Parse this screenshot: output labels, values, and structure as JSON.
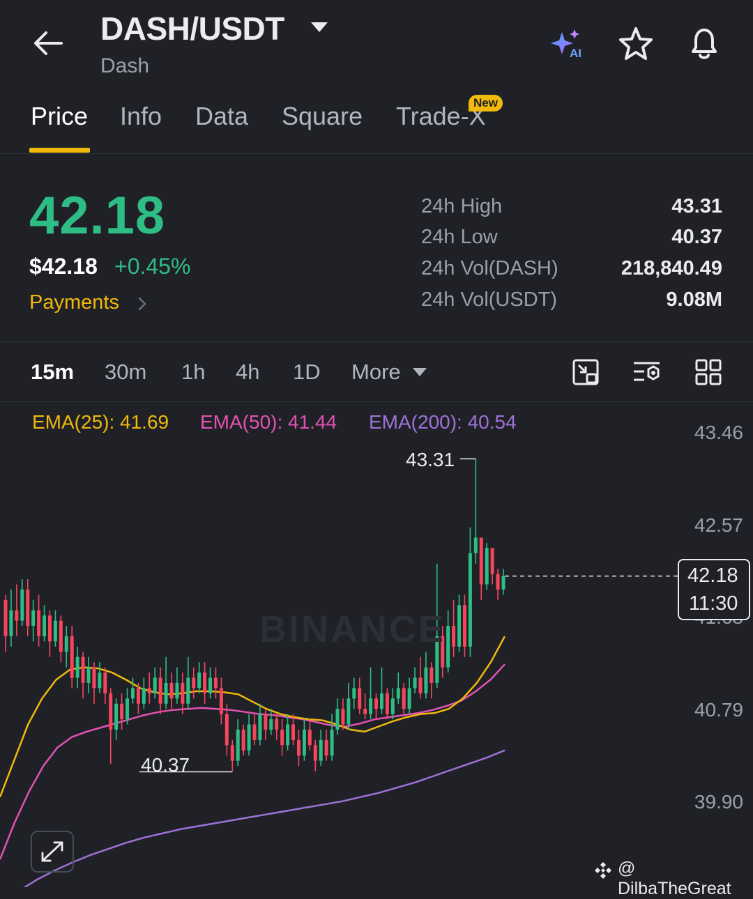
{
  "header": {
    "pair": "DASH/USDT",
    "coin_name": "Dash",
    "icons": [
      "back-arrow-icon",
      "ai-sparkle-icon",
      "star-icon",
      "bell-icon"
    ]
  },
  "tabs": [
    {
      "label": "Price",
      "active": true
    },
    {
      "label": "Info"
    },
    {
      "label": "Data"
    },
    {
      "label": "Square"
    },
    {
      "label": "Trade-X",
      "badge": "New"
    }
  ],
  "price": {
    "last": "42.18",
    "usd": "$42.18",
    "change": "+0.45%",
    "category": "Payments"
  },
  "stats": [
    {
      "label": "24h High",
      "value": "43.31"
    },
    {
      "label": "24h Low",
      "value": "40.37"
    },
    {
      "label": "24h Vol(DASH)",
      "value": "218,840.49"
    },
    {
      "label": "24h Vol(USDT)",
      "value": "9.08M"
    }
  ],
  "intervals": [
    "15m",
    "30m",
    "1h",
    "4h",
    "1D",
    "More"
  ],
  "active_interval": "15m",
  "ema": {
    "ema25": "EMA(25): 41.69",
    "ema50": "EMA(50): 41.44",
    "ema200": "EMA(200): 40.54"
  },
  "colors": {
    "up": "#2ebd85",
    "down": "#f6465d",
    "accent": "#f0b90b",
    "ema25": "#f0b90b",
    "ema50": "#e352b3",
    "ema200": "#9d72d6",
    "background": "#1f2127"
  },
  "chart_data": {
    "type": "candlestick",
    "y_axis_ticks": [
      "43.46",
      "42.57",
      "41.68",
      "40.79",
      "39.90"
    ],
    "ylim": [
      39.6,
      43.7
    ],
    "high_marker": "43.31",
    "low_marker": "40.37",
    "last_price": "42.18",
    "last_time": "11:30",
    "ema25": [
      40.05,
      40.4,
      40.75,
      41.0,
      41.18,
      41.28,
      41.3,
      41.29,
      41.25,
      41.18,
      41.1,
      41.06,
      41.04,
      41.05,
      41.07,
      41.07,
      41.06,
      41.04,
      40.97,
      40.9,
      40.85,
      40.82,
      40.8,
      40.79,
      40.75,
      40.7,
      40.68,
      40.73,
      40.78,
      40.82,
      40.85,
      40.86,
      40.9,
      41.0,
      41.15,
      41.35,
      41.6
    ],
    "ema50": [
      39.45,
      39.8,
      40.1,
      40.35,
      40.53,
      40.63,
      40.68,
      40.72,
      40.76,
      40.8,
      40.84,
      40.87,
      40.89,
      40.9,
      40.91,
      40.9,
      40.89,
      40.87,
      40.85,
      40.84,
      40.82,
      40.8,
      40.77,
      40.74,
      40.73,
      40.76,
      40.8,
      40.82,
      40.84,
      40.86,
      40.89,
      40.93,
      40.98,
      41.07,
      41.18,
      41.33
    ],
    "ema200": [
      39.03,
      39.14,
      39.25,
      39.34,
      39.42,
      39.49,
      39.55,
      39.61,
      39.66,
      39.7,
      39.74,
      39.77,
      39.8,
      39.83,
      39.86,
      39.89,
      39.92,
      39.95,
      39.98,
      40.01,
      40.05,
      40.09,
      40.14,
      40.19,
      40.25,
      40.31,
      40.37,
      40.43,
      40.5
    ],
    "candles": [
      [
        41.95,
        41.6,
        42.0,
        41.45
      ],
      [
        41.6,
        41.85,
        42.05,
        41.5
      ],
      [
        41.85,
        41.75,
        42.1,
        41.6
      ],
      [
        41.75,
        42.05,
        42.15,
        41.7
      ],
      [
        42.05,
        41.7,
        42.15,
        41.6
      ],
      [
        41.7,
        41.85,
        41.95,
        41.55
      ],
      [
        41.85,
        41.6,
        42.0,
        41.5
      ],
      [
        41.6,
        41.8,
        41.9,
        41.55
      ],
      [
        41.8,
        41.55,
        41.85,
        41.4
      ],
      [
        41.55,
        41.75,
        41.85,
        41.5
      ],
      [
        41.75,
        41.45,
        41.8,
        41.35
      ],
      [
        41.45,
        41.6,
        41.7,
        41.3
      ],
      [
        41.6,
        41.2,
        41.7,
        41.1
      ],
      [
        41.2,
        41.4,
        41.5,
        41.1
      ],
      [
        41.4,
        41.15,
        41.45,
        41.0
      ],
      [
        41.15,
        41.3,
        41.4,
        41.05
      ],
      [
        41.3,
        41.1,
        41.35,
        40.95
      ],
      [
        41.1,
        41.25,
        41.35,
        41.05
      ],
      [
        41.25,
        41.05,
        41.3,
        40.95
      ],
      [
        41.05,
        40.7,
        41.1,
        40.37
      ],
      [
        40.7,
        40.95,
        41.0,
        40.6
      ],
      [
        40.95,
        40.8,
        41.05,
        40.7
      ],
      [
        40.8,
        41.0,
        41.1,
        40.75
      ],
      [
        41.0,
        41.1,
        41.2,
        40.95
      ],
      [
        41.1,
        40.95,
        41.15,
        40.85
      ],
      [
        40.95,
        41.1,
        41.2,
        40.9
      ],
      [
        41.1,
        41.05,
        41.25,
        40.95
      ],
      [
        41.05,
        41.2,
        41.3,
        41.0
      ],
      [
        41.2,
        40.95,
        41.3,
        40.85
      ],
      [
        40.95,
        41.15,
        41.4,
        40.9
      ],
      [
        41.15,
        41.0,
        41.25,
        40.9
      ],
      [
        41.0,
        41.15,
        41.3,
        40.95
      ],
      [
        41.15,
        40.95,
        41.25,
        40.85
      ],
      [
        40.95,
        41.2,
        41.4,
        40.9
      ],
      [
        41.2,
        41.1,
        41.3,
        41.0
      ],
      [
        41.1,
        41.25,
        41.35,
        41.05
      ],
      [
        41.25,
        41.05,
        41.35,
        40.95
      ],
      [
        41.05,
        41.2,
        41.3,
        41.0
      ],
      [
        41.2,
        41.1,
        41.3,
        41.0
      ],
      [
        41.1,
        40.85,
        41.2,
        40.75
      ],
      [
        40.85,
        40.55,
        40.95,
        40.45
      ],
      [
        40.55,
        40.4,
        40.6,
        40.3
      ],
      [
        40.4,
        40.7,
        40.8,
        40.35
      ],
      [
        40.7,
        40.5,
        40.75,
        40.45
      ],
      [
        40.5,
        40.75,
        40.85,
        40.45
      ],
      [
        40.75,
        40.6,
        40.85,
        40.55
      ],
      [
        40.6,
        40.85,
        40.95,
        40.55
      ],
      [
        40.85,
        40.7,
        40.9,
        40.6
      ],
      [
        40.7,
        40.8,
        40.9,
        40.65
      ],
      [
        40.8,
        40.7,
        40.85,
        40.6
      ],
      [
        40.7,
        40.55,
        40.8,
        40.45
      ],
      [
        40.55,
        40.75,
        40.85,
        40.5
      ],
      [
        40.75,
        40.6,
        40.85,
        40.55
      ],
      [
        40.6,
        40.45,
        40.7,
        40.35
      ],
      [
        40.45,
        40.7,
        40.8,
        40.4
      ],
      [
        40.7,
        40.55,
        40.8,
        40.5
      ],
      [
        40.55,
        40.4,
        40.6,
        40.3
      ],
      [
        40.4,
        40.6,
        40.7,
        40.35
      ],
      [
        40.6,
        40.45,
        40.7,
        40.4
      ],
      [
        40.45,
        40.7,
        40.85,
        40.4
      ],
      [
        40.7,
        40.9,
        41.0,
        40.65
      ],
      [
        40.9,
        40.75,
        41.0,
        40.7
      ],
      [
        40.75,
        41.0,
        41.15,
        40.7
      ],
      [
        41.0,
        41.1,
        41.2,
        40.9
      ],
      [
        41.1,
        40.9,
        41.2,
        40.85
      ],
      [
        40.9,
        40.85,
        41.05,
        40.8
      ],
      [
        40.85,
        41.0,
        41.3,
        40.8
      ],
      [
        41.0,
        40.9,
        41.05,
        40.8
      ],
      [
        40.9,
        41.05,
        41.3,
        40.85
      ],
      [
        41.05,
        40.85,
        41.1,
        40.8
      ],
      [
        40.85,
        41.0,
        41.1,
        40.8
      ],
      [
        41.0,
        41.1,
        41.25,
        40.95
      ],
      [
        41.1,
        40.9,
        41.15,
        40.85
      ],
      [
        40.9,
        41.1,
        41.2,
        40.85
      ],
      [
        41.1,
        41.2,
        41.3,
        41.05
      ],
      [
        41.2,
        41.05,
        41.4,
        41.0
      ],
      [
        41.05,
        41.3,
        41.45,
        41.0
      ],
      [
        41.3,
        41.15,
        41.35,
        41.0
      ],
      [
        41.15,
        41.6,
        42.3,
        41.1
      ],
      [
        41.6,
        41.3,
        41.7,
        41.2
      ],
      [
        41.3,
        41.7,
        41.85,
        41.25
      ],
      [
        41.7,
        41.5,
        41.95,
        41.4
      ],
      [
        41.5,
        41.9,
        42.0,
        41.45
      ],
      [
        41.9,
        41.5,
        42.0,
        41.4
      ],
      [
        41.5,
        42.4,
        42.65,
        41.4
      ],
      [
        42.4,
        42.55,
        43.31,
        42.3
      ],
      [
        42.55,
        42.1,
        42.55,
        41.95
      ],
      [
        42.1,
        42.45,
        42.5,
        42.05
      ],
      [
        42.45,
        42.2,
        42.45,
        42.1
      ],
      [
        42.2,
        42.05,
        42.25,
        41.95
      ],
      [
        42.05,
        42.18,
        42.25,
        42.0
      ]
    ]
  },
  "watermark": "BINANCE",
  "credit": "@ DilbaTheGreat"
}
